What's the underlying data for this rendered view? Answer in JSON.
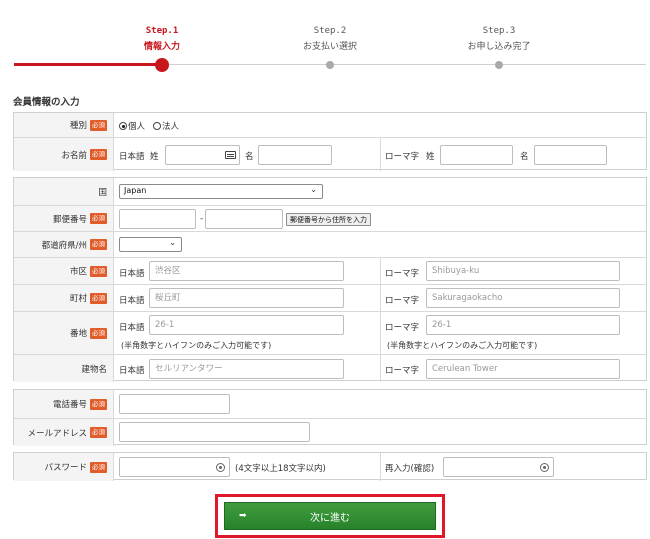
{
  "steps": [
    {
      "num": "Step.1",
      "label": "情報入力"
    },
    {
      "num": "Step.2",
      "label": "お支払い選択"
    },
    {
      "num": "Step.3",
      "label": "お申し込み完了"
    }
  ],
  "section_title": "会員情報の入力",
  "required_badge": "必須",
  "member": {
    "type_label": "種別",
    "type_options": [
      "個人",
      "法人"
    ],
    "name_label": "お名前",
    "jp_label": "日本語",
    "roman_label": "ローマ字",
    "sei": "姓",
    "mei": "名"
  },
  "address": {
    "country_label": "国",
    "country_value": "Japan",
    "zip_label": "郵便番号",
    "zip_dash": "-",
    "zip_button": "郵便番号から住所を入力",
    "pref_label": "都道府県/州",
    "city_label": "市区",
    "city_jp": "渋谷区",
    "city_roman": "Shibuya-ku",
    "town_label": "町村",
    "town_jp": "桜丘町",
    "town_roman": "Sakuragaokacho",
    "block_label": "番地",
    "block_jp": "26-1",
    "block_roman": "26-1",
    "block_note": "(半角数字とハイフンのみご入力可能です)",
    "building_label": "建物名",
    "building_jp": "セルリアンタワー",
    "building_roman": "Cerulean Tower",
    "jp_label": "日本語",
    "roman_label": "ローマ字"
  },
  "contact": {
    "phone_label": "電話番号",
    "email_label": "メールアドレス"
  },
  "password": {
    "label": "パスワード",
    "hint": "(4文字以上18文字以内)",
    "confirm_label": "再入力(確認)"
  },
  "next_button": "次に進む",
  "colors": {
    "accent": "#c8161d",
    "button_green": "#2f8f30",
    "required": "#e05c2a"
  }
}
